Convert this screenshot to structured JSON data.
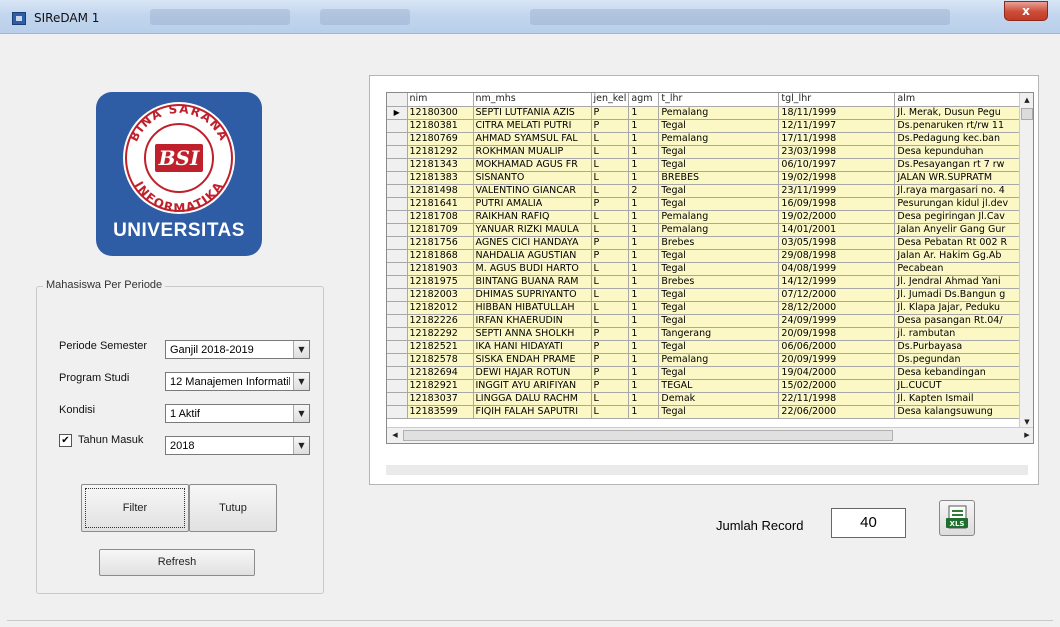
{
  "window": {
    "title": "SIReDAM 1",
    "close_label": "x"
  },
  "logo": {
    "ring_top": "BINA SARANA",
    "ring_bottom": "INFORMATIKA",
    "mark": "BSI",
    "caption": "UNIVERSITAS"
  },
  "filter_group": {
    "legend": "Mahasiswa Per Periode",
    "periode_label": "Periode Semester",
    "periode_value": "Ganjil 2018-2019",
    "prodi_label": "Program Studi",
    "prodi_value": "12  Manajemen Informatil",
    "kondisi_label": "Kondisi",
    "kondisi_value": "1  Aktif",
    "tahun_label": "Tahun Masuk",
    "tahun_checked": "✔",
    "tahun_value": "2018",
    "filter_button": "Filter",
    "tutup_button": "Tutup",
    "refresh_button": "Refresh"
  },
  "grid": {
    "columns": [
      "nim",
      "nm_mhs",
      "jen_kel",
      "agm",
      "t_lhr",
      "tgl_lhr",
      "alm"
    ],
    "current_row_marker": "▶",
    "rows": [
      [
        "12180300",
        "SEPTI LUTFANIA AZIS",
        "P",
        "1",
        "Pemalang",
        "18/11/1999",
        "Jl. Merak, Dusun Pegu"
      ],
      [
        "12180381",
        "CITRA MELATI PUTRI",
        "P",
        "1",
        "Tegal",
        "12/11/1997",
        "Ds.penaruken rt/rw 11"
      ],
      [
        "12180769",
        "AHMAD SYAMSUL FAL",
        "L",
        "1",
        "Pemalang",
        "17/11/1998",
        "Ds.Pedagung kec.ban"
      ],
      [
        "12181292",
        "ROKHMAN MUALIP",
        "L",
        "1",
        "Tegal",
        "23/03/1998",
        "Desa kepunduhan"
      ],
      [
        "12181343",
        "MOKHAMAD AGUS FR",
        "L",
        "1",
        "Tegal",
        "06/10/1997",
        "Ds.Pesayangan rt 7 rw"
      ],
      [
        "12181383",
        "SISNANTO",
        "L",
        "1",
        "BREBES",
        "19/02/1998",
        "JALAN WR.SUPRATM"
      ],
      [
        "12181498",
        "VALENTINO GIANCAR",
        "L",
        "2",
        "Tegal",
        "23/11/1999",
        "Jl.raya margasari no. 4"
      ],
      [
        "12181641",
        "PUTRI AMALIA",
        "P",
        "1",
        "Tegal",
        "16/09/1998",
        "Pesurungan kidul jl.dev"
      ],
      [
        "12181708",
        "RAIKHAN RAFIQ",
        "L",
        "1",
        "Pemalang",
        "19/02/2000",
        "Desa pegiringan Jl.Cav"
      ],
      [
        "12181709",
        "YANUAR RIZKI MAULA",
        "L",
        "1",
        "Pemalang",
        "14/01/2001",
        "Jalan Anyelir Gang Gur"
      ],
      [
        "12181756",
        "AGNES CICI HANDAYA",
        "P",
        "1",
        "Brebes",
        "03/05/1998",
        "Desa Pebatan Rt 002 R"
      ],
      [
        "12181868",
        "NAHDALIA AGUSTIAN",
        "P",
        "1",
        "Tegal",
        "29/08/1998",
        "Jalan Ar. Hakim Gg.Ab"
      ],
      [
        "12181903",
        "M. AGUS BUDI HARTO",
        "L",
        "1",
        "Tegal",
        "04/08/1999",
        "Pecabean"
      ],
      [
        "12181975",
        "BINTANG BUANA RAM",
        "L",
        "1",
        "Brebes",
        "14/12/1999",
        "Jl. Jendral Ahmad Yani"
      ],
      [
        "12182003",
        "DHIMAS SUPRIYANTO",
        "L",
        "1",
        "Tegal",
        "07/12/2000",
        "Jl. Jumadi Ds.Bangun g"
      ],
      [
        "12182012",
        "HIBBAN HIBATULLAH",
        "L",
        "1",
        "Tegal",
        "28/12/2000",
        "Jl. Klapa Jajar, Peduku"
      ],
      [
        "12182226",
        "IRFAN KHAERUDIN",
        "L",
        "1",
        "Tegal",
        "24/09/1999",
        "Desa pasangan Rt.04/"
      ],
      [
        "12182292",
        "SEPTI ANNA SHOLKH",
        "P",
        "1",
        "Tangerang",
        "20/09/1998",
        "jl. rambutan"
      ],
      [
        "12182521",
        "IKA HANI HIDAYATI",
        "P",
        "1",
        "Tegal",
        "06/06/2000",
        "Ds.Purbayasa"
      ],
      [
        "12182578",
        "SISKA ENDAH PRAME",
        "P",
        "1",
        "Pemalang",
        "20/09/1999",
        "Ds.pegundan"
      ],
      [
        "12182694",
        "DEWI HAJAR ROTUN",
        "P",
        "1",
        "Tegal",
        "19/04/2000",
        "Desa kebandingan"
      ],
      [
        "12182921",
        "INGGIT AYU ARIFIYAN",
        "P",
        "1",
        "TEGAL",
        "15/02/2000",
        "JL.CUCUT"
      ],
      [
        "12183037",
        "LINGGA DALU RACHM",
        "L",
        "1",
        "Demak",
        "22/11/1998",
        "Jl. Kapten Ismail"
      ],
      [
        "12183599",
        "FIQIH FALAH SAPUTRI",
        "L",
        "1",
        "Tegal",
        "22/06/2000",
        "Desa kalangsuwung"
      ]
    ]
  },
  "jumlah_record": {
    "label": "Jumlah Record",
    "value": "40"
  },
  "export": {
    "icon": "excel-export-icon",
    "badge": "XLS"
  },
  "colors": {
    "logo_blue": "#2e5da5",
    "row_yellow": "#fbf8c6"
  }
}
